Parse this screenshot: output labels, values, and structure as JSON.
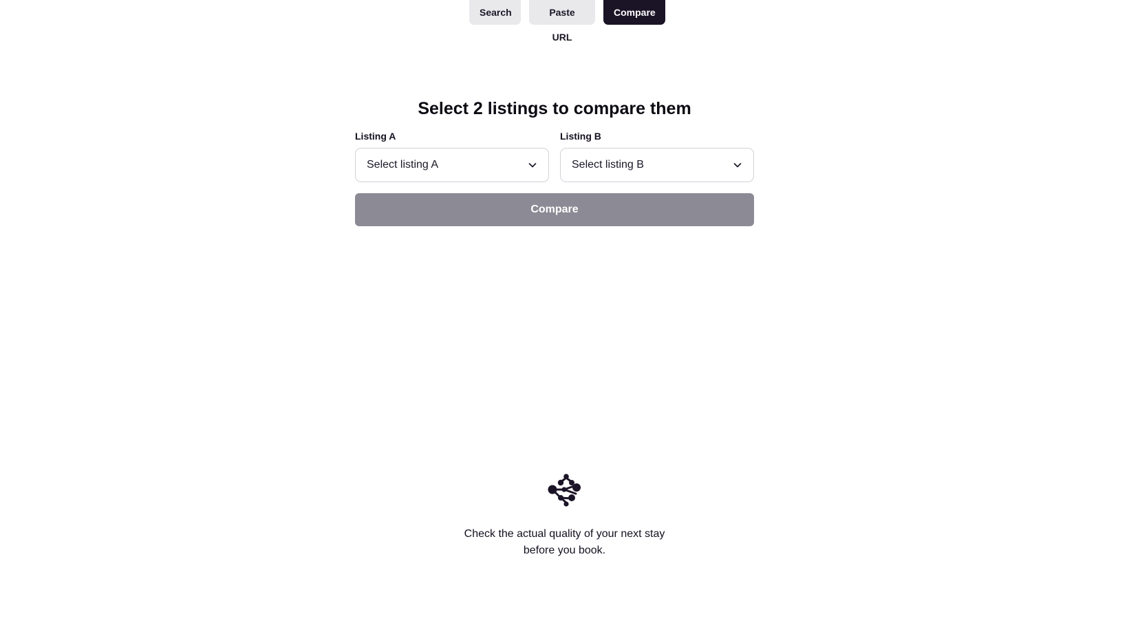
{
  "tabs": [
    {
      "label": "Search",
      "active": false
    },
    {
      "label": "Paste URL",
      "active": false
    },
    {
      "label": "Compare",
      "active": true
    }
  ],
  "compare": {
    "title": "Select 2 listings to compare them",
    "listing_a": {
      "label": "Listing A",
      "placeholder": "Select listing A"
    },
    "listing_b": {
      "label": "Listing B",
      "placeholder": "Select listing B"
    },
    "button_label": "Compare",
    "button_disabled": true
  },
  "footer": {
    "logo_icon": "network-nodes-icon",
    "tagline": "Check the actual quality of your next stay before you book."
  },
  "colors": {
    "active_tab": "#1b1427",
    "inactive_tab": "#e9e9ec",
    "disabled_button": "#8c8a94",
    "text": "#15101e"
  }
}
